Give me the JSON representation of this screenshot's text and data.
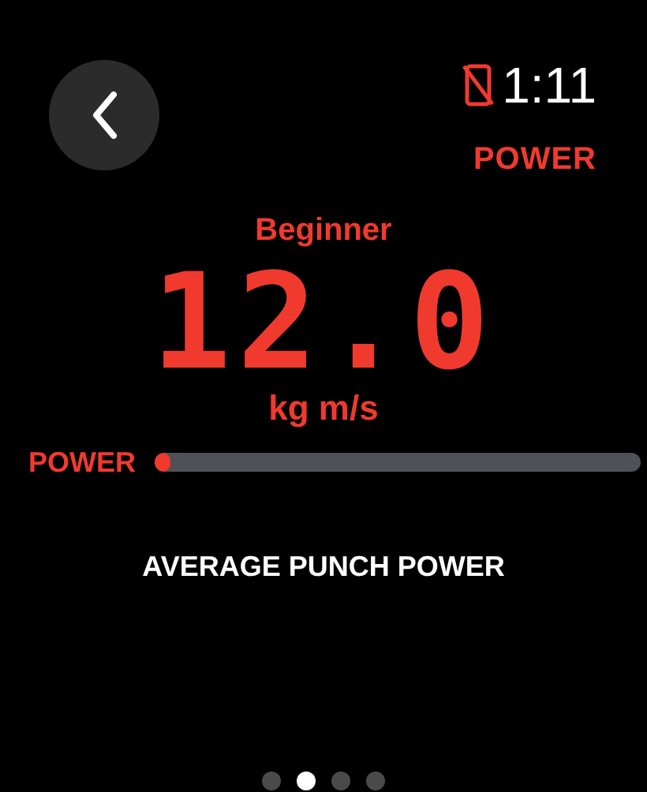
{
  "status": {
    "time": "1:11",
    "phone_disconnected": true
  },
  "header": {
    "title": "POWER"
  },
  "level_label": "Beginner",
  "value": "12.0",
  "unit": "kg m/s",
  "meter": {
    "label": "POWER",
    "level": 0.02
  },
  "caption": "AVERAGE PUNCH POWER",
  "pages": [
    {
      "selected": false
    },
    {
      "selected": true
    },
    {
      "selected": false
    },
    {
      "selected": false
    }
  ]
}
